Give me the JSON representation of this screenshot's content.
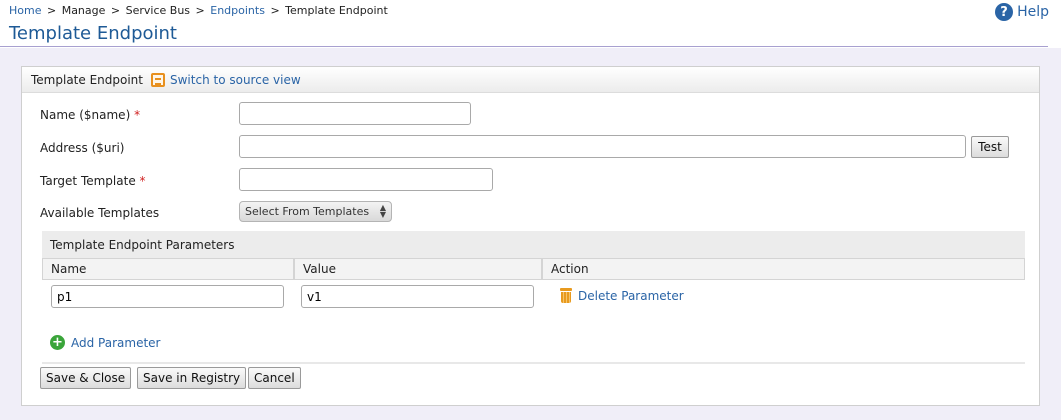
{
  "breadcrumb": {
    "items": [
      {
        "label": "Home",
        "link": true
      },
      {
        "label": "Manage",
        "link": false
      },
      {
        "label": "Service Bus",
        "link": false
      },
      {
        "label": "Endpoints",
        "link": true
      },
      {
        "label": "Template Endpoint",
        "link": false
      }
    ],
    "separator": ">"
  },
  "help": {
    "label": "Help",
    "icon": "help-icon"
  },
  "page": {
    "title": "Template Endpoint"
  },
  "panel": {
    "title": "Template Endpoint",
    "switch_label": "Switch to source view"
  },
  "form": {
    "name": {
      "label": "Name ($name)",
      "required": "*",
      "value": ""
    },
    "address": {
      "label": "Address ($uri)",
      "value": "",
      "test_label": "Test"
    },
    "target": {
      "label": "Target Template",
      "required": "*",
      "value": ""
    },
    "available": {
      "label": "Available Templates",
      "selected": "Select From Templates"
    }
  },
  "params": {
    "title": "Template Endpoint Parameters",
    "columns": [
      "Name",
      "Value",
      "Action"
    ],
    "rows": [
      {
        "name": "p1",
        "value": "v1",
        "action": "Delete Parameter"
      }
    ],
    "add_label": "Add Parameter"
  },
  "actions": {
    "save_close": "Save & Close",
    "save_registry": "Save in Registry",
    "cancel": "Cancel"
  },
  "colors": {
    "link": "#2a64a6",
    "title": "#1e5a96",
    "required": "#d02020",
    "background": "#f0eef8"
  }
}
